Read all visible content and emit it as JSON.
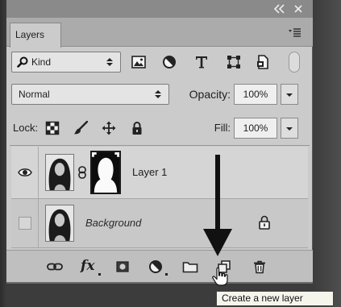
{
  "window": {
    "collapse_icon": "double-chevron-left-icon",
    "close_icon": "close-icon"
  },
  "panel": {
    "tab_label": "Layers",
    "menu_icon": "panel-menu-icon"
  },
  "filter": {
    "search_icon": "search-icon",
    "kind": "Kind",
    "type_icons": [
      "pixel-layer-filter-icon",
      "adjustment-layer-filter-icon",
      "type-layer-filter-icon",
      "shape-layer-filter-icon",
      "smart-object-filter-icon"
    ]
  },
  "blend": {
    "mode": "Normal",
    "opacity_label": "Opacity:",
    "opacity_value": "100%"
  },
  "lock": {
    "label": "Lock:",
    "icons": [
      "lock-transparent-pixels-icon",
      "lock-image-pixels-icon",
      "lock-position-icon",
      "lock-all-icon"
    ],
    "fill_label": "Fill:",
    "fill_value": "100%"
  },
  "layers": [
    {
      "name": "Layer 1",
      "visible": true,
      "has_mask": true,
      "locked": false
    },
    {
      "name": "Background",
      "visible": false,
      "has_mask": false,
      "locked": true
    }
  ],
  "bottom_bar": {
    "link_icon": "link-layers-icon",
    "fx_label": "fx",
    "icons": [
      "add-mask-icon",
      "adjustment-layer-icon",
      "group-folder-icon",
      "new-layer-icon",
      "trash-icon"
    ]
  },
  "tooltip": {
    "text": "Create a new layer"
  },
  "theme": {
    "panel_bg": "#cbcbcb",
    "row_bg": "#d5d5d5",
    "text_color": "#1e1e1e"
  }
}
